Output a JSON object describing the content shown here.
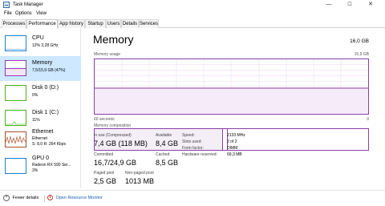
{
  "window": {
    "title": "Task Manager",
    "min": "—",
    "max": "☐",
    "close": "✕"
  },
  "menu": [
    "File",
    "Options",
    "View"
  ],
  "tabs": [
    "Processes",
    "Performance",
    "App history",
    "Startup",
    "Users",
    "Details",
    "Services"
  ],
  "sidebar": [
    {
      "name": "CPU",
      "sub": "12%  3,28 GHz",
      "color": "#1e7fd0"
    },
    {
      "name": "Memory",
      "sub": "7,5/15,9 GB (47%)",
      "color": "#8b3fa8"
    },
    {
      "name": "Disk 0 (D:)",
      "sub": "0%",
      "color": "#4caf1c"
    },
    {
      "name": "Disk 1 (C:)",
      "sub": "11%",
      "color": "#4caf1c"
    },
    {
      "name": "Ethernet",
      "sub": "Ethernet",
      "sub2": "S: 8,0  R: 264 Kbps",
      "color": "#a0522d"
    },
    {
      "name": "GPU 0",
      "sub": "Radeon RX 590 Ser...",
      "sub2": "3%",
      "color": "#1e7fd0"
    }
  ],
  "main": {
    "title": "Memory",
    "total": "16,0 GB",
    "usage_label": "Memory usage",
    "usage_max": "15,9 GB",
    "x_left": "60 seconds",
    "x_right": "0",
    "composition_label": "Memory composition",
    "usage_fraction": 0.47
  },
  "stats": {
    "in_use_label": "In use (Compressed)",
    "in_use": "7,4 GB (118 MB)",
    "available_label": "Available",
    "available": "8,4 GB",
    "committed_label": "Committed",
    "committed": "16,7/24,9 GB",
    "cached_label": "Cached",
    "cached": "8,5 GB",
    "paged_label": "Paged pool",
    "paged": "2,5 GB",
    "nonpaged_label": "Non-paged pool",
    "nonpaged": "1013 MB"
  },
  "details": [
    {
      "k": "Speed:",
      "v": "2133 MHz"
    },
    {
      "k": "Slots used:",
      "v": "2 of 2"
    },
    {
      "k": "Form factor:",
      "v": "DIMM"
    },
    {
      "k": "Hardware reserved:",
      "v": "69,3 MB"
    }
  ],
  "footer": {
    "fewer": "Fewer details",
    "monitor": "Open Resource Monitor"
  }
}
